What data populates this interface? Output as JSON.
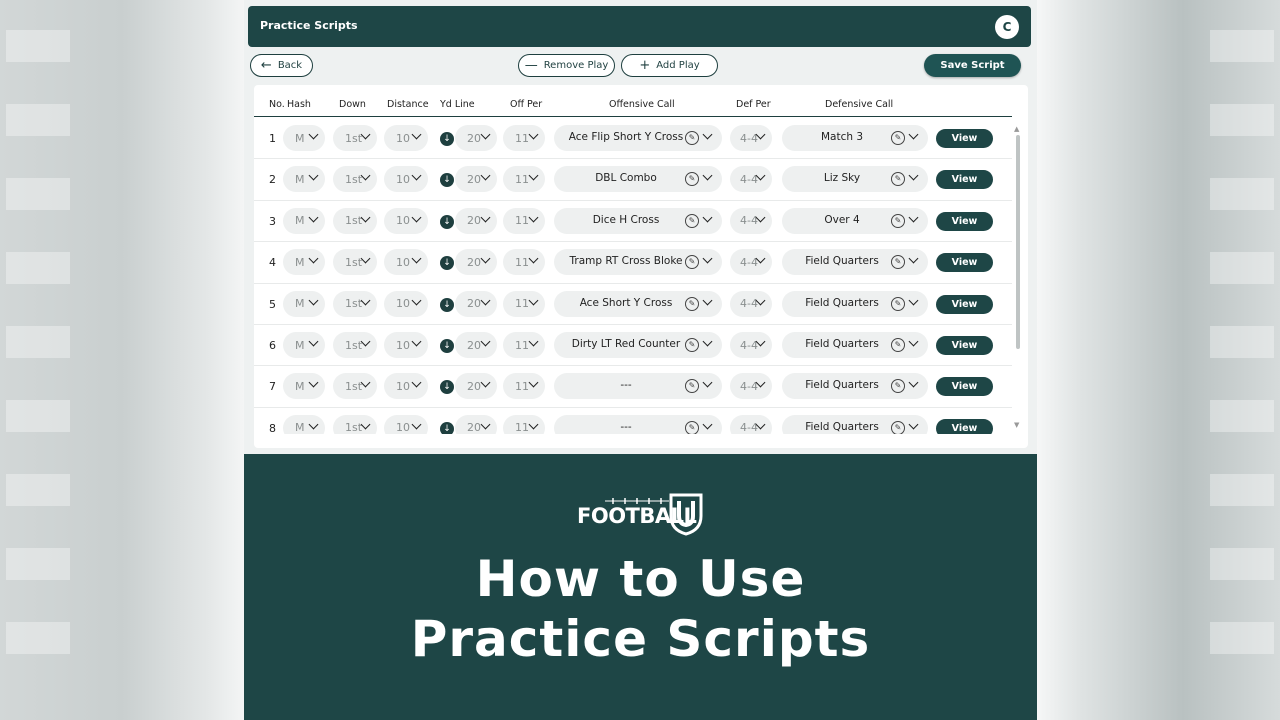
{
  "app": {
    "title": "Practice Scripts",
    "avatar_initial": "C",
    "back_label": "Back",
    "remove_play_label": "Remove Play",
    "add_play_label": "Add Play",
    "save_script_label": "Save Script"
  },
  "table": {
    "columns": {
      "no": "No.",
      "hash": "Hash",
      "down": "Down",
      "distance": "Distance",
      "yd_line": "Yd Line",
      "off_per": "Off Per",
      "offensive_call": "Offensive Call",
      "def_per": "Def Per",
      "defensive_call": "Defensive Call"
    },
    "view_label": "View",
    "rows": [
      {
        "no": "1",
        "hash": "M",
        "down": "1st",
        "distance": "10",
        "yd_line": "20",
        "off_per": "11",
        "offensive_call": "Ace Flip Short Y Cross",
        "def_per": "4-4",
        "defensive_call": "Match 3"
      },
      {
        "no": "2",
        "hash": "M",
        "down": "1st",
        "distance": "10",
        "yd_line": "20",
        "off_per": "11",
        "offensive_call": "DBL Combo",
        "def_per": "4-4",
        "defensive_call": "Liz Sky"
      },
      {
        "no": "3",
        "hash": "M",
        "down": "1st",
        "distance": "10",
        "yd_line": "20",
        "off_per": "11",
        "offensive_call": "Dice H Cross",
        "def_per": "4-4",
        "defensive_call": "Over 4"
      },
      {
        "no": "4",
        "hash": "M",
        "down": "1st",
        "distance": "10",
        "yd_line": "20",
        "off_per": "11",
        "offensive_call": "Tramp RT Cross Bloke",
        "def_per": "4-4",
        "defensive_call": "Field Quarters"
      },
      {
        "no": "5",
        "hash": "M",
        "down": "1st",
        "distance": "10",
        "yd_line": "20",
        "off_per": "11",
        "offensive_call": "Ace Short Y Cross",
        "def_per": "4-4",
        "defensive_call": "Field Quarters"
      },
      {
        "no": "6",
        "hash": "M",
        "down": "1st",
        "distance": "10",
        "yd_line": "20",
        "off_per": "11",
        "offensive_call": "Dirty LT Red Counter",
        "def_per": "4-4",
        "defensive_call": "Field Quarters"
      },
      {
        "no": "7",
        "hash": "M",
        "down": "1st",
        "distance": "10",
        "yd_line": "20",
        "off_per": "11",
        "offensive_call": "---",
        "def_per": "4-4",
        "defensive_call": "Field Quarters"
      },
      {
        "no": "8",
        "hash": "M",
        "down": "1st",
        "distance": "10",
        "yd_line": "20",
        "off_per": "11",
        "offensive_call": "---",
        "def_per": "4-4",
        "defensive_call": "Field Quarters"
      }
    ]
  },
  "banner": {
    "logo_text": "FOOTBALL",
    "headline_line1": "How to Use",
    "headline_line2": "Practice Scripts"
  },
  "colors": {
    "brand_dark": "#1e4646",
    "save_button": "#1f5454",
    "pill_bg": "#eef0f0"
  }
}
